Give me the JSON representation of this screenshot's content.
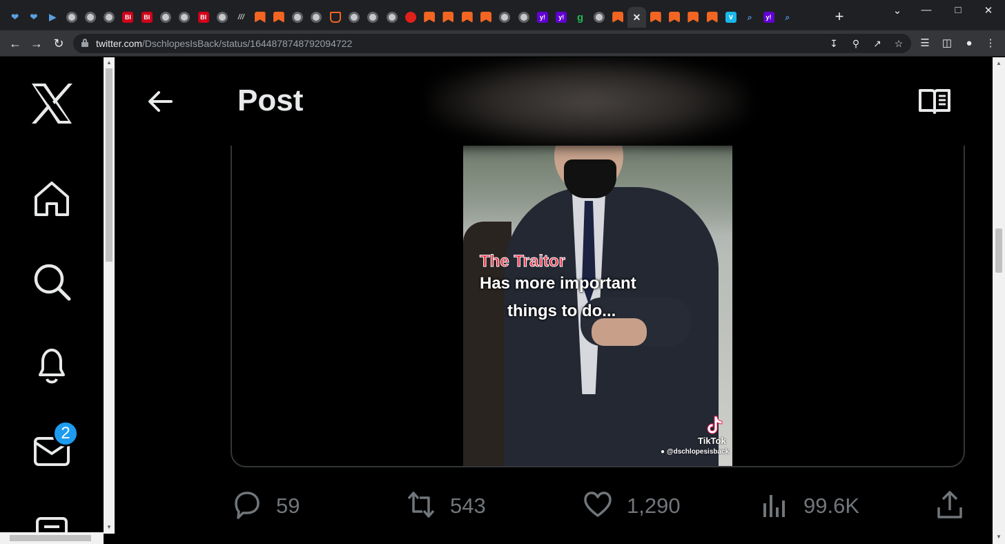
{
  "browser": {
    "tabs": [
      {
        "icon": "shield-icon",
        "glyph": "❤"
      },
      {
        "icon": "shield-icon",
        "glyph": "❤"
      },
      {
        "icon": "arrow-icon",
        "glyph": "▶"
      },
      {
        "icon": "globe-icon",
        "glyph": ""
      },
      {
        "icon": "globe-icon",
        "glyph": ""
      },
      {
        "icon": "globe-icon",
        "glyph": ""
      },
      {
        "icon": "business-insider-icon",
        "glyph": "BI"
      },
      {
        "icon": "business-insider-icon",
        "glyph": "BI"
      },
      {
        "icon": "globe-icon",
        "glyph": ""
      },
      {
        "icon": "globe-icon",
        "glyph": ""
      },
      {
        "icon": "business-insider-icon",
        "glyph": "BI"
      },
      {
        "icon": "globe-icon",
        "glyph": ""
      },
      {
        "icon": "stripes-icon",
        "glyph": "///"
      },
      {
        "icon": "bookmark-icon",
        "glyph": ""
      },
      {
        "icon": "bookmark-icon",
        "glyph": ""
      },
      {
        "icon": "globe-icon",
        "glyph": ""
      },
      {
        "icon": "globe-icon",
        "glyph": ""
      },
      {
        "icon": "pocket-icon",
        "glyph": ""
      },
      {
        "icon": "globe-icon",
        "glyph": ""
      },
      {
        "icon": "globe-icon",
        "glyph": ""
      },
      {
        "icon": "globe-icon",
        "glyph": ""
      },
      {
        "icon": "red-pin-icon",
        "glyph": ""
      },
      {
        "icon": "bookmark-icon",
        "glyph": ""
      },
      {
        "icon": "bookmark-icon",
        "glyph": ""
      },
      {
        "icon": "bookmark-icon",
        "glyph": ""
      },
      {
        "icon": "bookmark-icon",
        "glyph": ""
      },
      {
        "icon": "globe-icon",
        "glyph": ""
      },
      {
        "icon": "globe-icon",
        "glyph": ""
      },
      {
        "icon": "yahoo-icon",
        "glyph": "y!"
      },
      {
        "icon": "yahoo-icon",
        "glyph": "y!"
      },
      {
        "icon": "grammarly-icon",
        "glyph": "g"
      },
      {
        "icon": "globe-icon",
        "glyph": ""
      },
      {
        "icon": "bookmark-icon",
        "glyph": ""
      },
      {
        "icon": "close-icon",
        "glyph": "✕",
        "active": true
      },
      {
        "icon": "bookmark-icon",
        "glyph": ""
      },
      {
        "icon": "bookmark-icon",
        "glyph": ""
      },
      {
        "icon": "bookmark-icon",
        "glyph": ""
      },
      {
        "icon": "bookmark-icon",
        "glyph": ""
      },
      {
        "icon": "vimeo-icon",
        "glyph": "v"
      },
      {
        "icon": "search-icon",
        "glyph": "⌕"
      },
      {
        "icon": "yahoo-icon",
        "glyph": "y!"
      },
      {
        "icon": "search-icon",
        "glyph": "⌕"
      }
    ],
    "url_host": "twitter.com",
    "url_path": "/DschlopesIsBack/status/1644878748792094722"
  },
  "header": {
    "title": "Post"
  },
  "sidebar": {
    "messages_badge": "2"
  },
  "video": {
    "caption_red": "The Traitor",
    "caption_line1": "Has more important",
    "caption_line2": "things to do...",
    "watermark": "TikTok",
    "handle": "@dschlopesisback"
  },
  "actions": {
    "replies": "59",
    "reposts": "543",
    "likes": "1,290",
    "views": "99.6K"
  },
  "colors": {
    "accent": "#1d9bf0",
    "text_primary": "#e7e9ea",
    "text_secondary": "#71767b",
    "caption_red": "#e8324a"
  }
}
